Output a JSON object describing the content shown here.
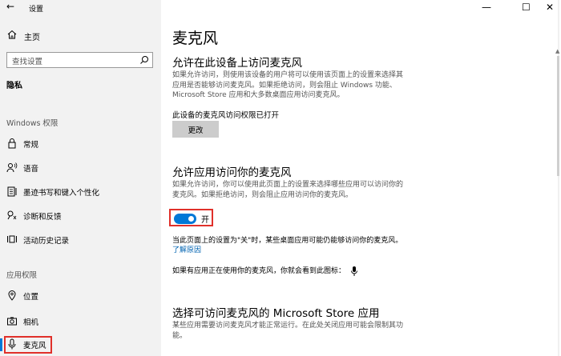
{
  "window": {
    "title": "设置",
    "controls": {
      "minimize": "—",
      "maximize": "☐",
      "close": "✕"
    }
  },
  "sidebar": {
    "back_icon": "←",
    "home": {
      "label": "主页",
      "icon": "home-icon"
    },
    "search": {
      "placeholder": "查找设置",
      "icon": "search-icon"
    },
    "section_title": "隐私",
    "groups": [
      {
        "title": "Windows 权限",
        "items": [
          {
            "label": "常规",
            "icon": "lock-icon"
          },
          {
            "label": "语音",
            "icon": "speech-icon"
          },
          {
            "label": "墨迹书写和键入个性化",
            "icon": "ink-icon"
          },
          {
            "label": "诊断和反馈",
            "icon": "feedback-icon"
          },
          {
            "label": "活动历史记录",
            "icon": "history-icon"
          }
        ]
      },
      {
        "title": "应用权限",
        "items": [
          {
            "label": "位置",
            "icon": "location-icon"
          },
          {
            "label": "相机",
            "icon": "camera-icon"
          },
          {
            "label": "麦克风",
            "icon": "microphone-icon",
            "active": true
          }
        ]
      }
    ]
  },
  "main": {
    "page_title": "麦克风",
    "section1": {
      "title": "允许在此设备上访问麦克风",
      "desc_line1": "如果允许访问，则使用该设备的用户将可以使用该页面上的设置来选择其",
      "desc_line2": "应用是否能够访问麦克风。如果拒绝访问，则会阻止 Windows 功能、",
      "desc_line3": "Microsoft Store 应用和大多数桌面应用访问麦克风。",
      "status": "此设备的麦克风访问权限已打开",
      "button": "更改"
    },
    "section2": {
      "title": "允许应用访问你的麦克风",
      "desc_line1": "如果允许访问，你可以使用此页面上的设置来选择哪些应用可以访问你的",
      "desc_line2": "麦克风。如果拒绝访问，则会阻止应用访问你的麦克风。",
      "toggle_label": "开",
      "toggle_on": true,
      "note": "当此页面上的设置为\"关\"时，某些桌面应用可能仍能够访问你的麦克风。",
      "link": "了解原因",
      "note2": "如果有应用正在使用你的麦克风，你就会看到此图标："
    },
    "section3": {
      "title": "选择可访问麦克风的 Microsoft Store 应用",
      "desc_line1": "某些应用需要访问麦克风才能正常运行。在此处关闭应用可能会限制其功",
      "desc_line2": "能。"
    }
  },
  "colors": {
    "accent": "#0078d7",
    "highlight": "#e0302a",
    "sidebar_bg": "#f2f2f2",
    "link": "#0063b1"
  }
}
